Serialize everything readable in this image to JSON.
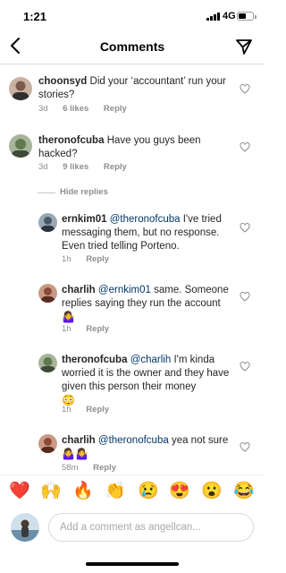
{
  "status_bar": {
    "time": "1:21",
    "network": "4G"
  },
  "header": {
    "title": "Comments",
    "back_icon": "chevron-left-icon",
    "send_icon": "paper-plane-icon"
  },
  "comments": [
    {
      "username": "choonsyd",
      "text": "Did your ‘accountant’ run your stories?",
      "time": "3d",
      "likes": "6 likes",
      "reply": "Reply",
      "avatar_color": "#7a5a4a"
    },
    {
      "username": "theronofcuba",
      "text": "Have you guys been hacked?",
      "time": "3d",
      "likes": "9 likes",
      "reply": "Reply",
      "avatar_color": "#5e7a4e"
    }
  ],
  "hide_replies": "Hide replies",
  "replies": [
    {
      "username": "ernkim01",
      "mention": "@theronofcuba",
      "text": "I've tried messaging them, but no response. Even tried telling Porteno.",
      "time": "1h",
      "reply": "Reply",
      "avatar_color": "#4a5a6a"
    },
    {
      "username": "charlih",
      "mention": "@ernkim01",
      "text": "same. Someone replies saying they run the account",
      "emoji": "🤷‍♀️",
      "time": "1h",
      "reply": "Reply",
      "avatar_color": "#8a4a3a"
    },
    {
      "username": "theronofcuba",
      "mention": "@charlih",
      "text": "I'm kinda worried it is the owner and they have given this person their money",
      "emoji": "😳",
      "time": "1h",
      "reply": "Reply",
      "avatar_color": "#5e7a4e"
    },
    {
      "username": "charlih",
      "mention": "@theronofcuba",
      "text": "yea not sure",
      "emoji": "🤷‍♀️🤷‍♀️",
      "time": "58m",
      "reply": "Reply",
      "avatar_color": "#8a4a3a"
    }
  ],
  "emoji_bar": [
    "❤️",
    "🙌",
    "🔥",
    "👏",
    "😢",
    "😍",
    "😮",
    "😂"
  ],
  "composer": {
    "placeholder": "Add a comment as angellcan...",
    "avatar_color": "#6a8fa8"
  },
  "colors": {
    "mention": "#00376b",
    "meta": "#8e8e8e",
    "border": "#dbdbdb"
  }
}
